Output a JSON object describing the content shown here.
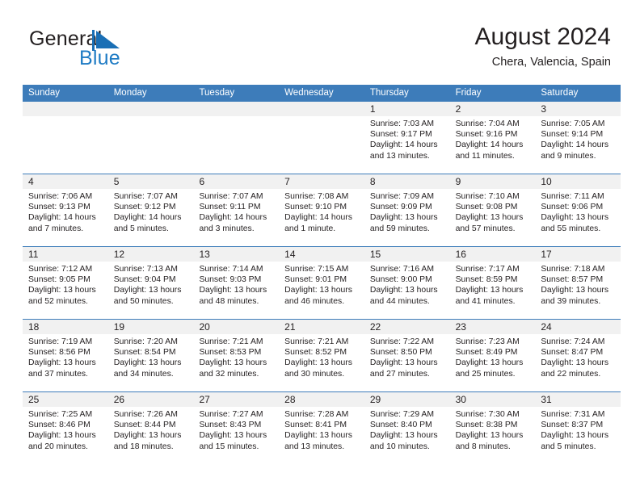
{
  "logo": {
    "word_one": "General",
    "word_two": "Blue",
    "mark": "triangle-flag-icon",
    "accent_color": "#1e7bc4"
  },
  "header": {
    "title": "August 2024",
    "location": "Chera, Valencia, Spain"
  },
  "theme": {
    "header_bar": "#3d7cba",
    "date_band": "#f1f1f1",
    "text": "#231f20",
    "rule": "#3d7cba"
  },
  "weekday_headers": [
    "Sunday",
    "Monday",
    "Tuesday",
    "Wednesday",
    "Thursday",
    "Friday",
    "Saturday"
  ],
  "weeks": [
    [
      {
        "day": "",
        "empty": true,
        "sunrise": "",
        "sunset": "",
        "daylight_a": "",
        "daylight_b": ""
      },
      {
        "day": "",
        "empty": true,
        "sunrise": "",
        "sunset": "",
        "daylight_a": "",
        "daylight_b": ""
      },
      {
        "day": "",
        "empty": true,
        "sunrise": "",
        "sunset": "",
        "daylight_a": "",
        "daylight_b": ""
      },
      {
        "day": "",
        "empty": true,
        "sunrise": "",
        "sunset": "",
        "daylight_a": "",
        "daylight_b": ""
      },
      {
        "day": "1",
        "sunrise": "Sunrise: 7:03 AM",
        "sunset": "Sunset: 9:17 PM",
        "daylight_a": "Daylight: 14 hours",
        "daylight_b": "and 13 minutes."
      },
      {
        "day": "2",
        "sunrise": "Sunrise: 7:04 AM",
        "sunset": "Sunset: 9:16 PM",
        "daylight_a": "Daylight: 14 hours",
        "daylight_b": "and 11 minutes."
      },
      {
        "day": "3",
        "sunrise": "Sunrise: 7:05 AM",
        "sunset": "Sunset: 9:14 PM",
        "daylight_a": "Daylight: 14 hours",
        "daylight_b": "and 9 minutes."
      }
    ],
    [
      {
        "day": "4",
        "sunrise": "Sunrise: 7:06 AM",
        "sunset": "Sunset: 9:13 PM",
        "daylight_a": "Daylight: 14 hours",
        "daylight_b": "and 7 minutes."
      },
      {
        "day": "5",
        "sunrise": "Sunrise: 7:07 AM",
        "sunset": "Sunset: 9:12 PM",
        "daylight_a": "Daylight: 14 hours",
        "daylight_b": "and 5 minutes."
      },
      {
        "day": "6",
        "sunrise": "Sunrise: 7:07 AM",
        "sunset": "Sunset: 9:11 PM",
        "daylight_a": "Daylight: 14 hours",
        "daylight_b": "and 3 minutes."
      },
      {
        "day": "7",
        "sunrise": "Sunrise: 7:08 AM",
        "sunset": "Sunset: 9:10 PM",
        "daylight_a": "Daylight: 14 hours",
        "daylight_b": "and 1 minute."
      },
      {
        "day": "8",
        "sunrise": "Sunrise: 7:09 AM",
        "sunset": "Sunset: 9:09 PM",
        "daylight_a": "Daylight: 13 hours",
        "daylight_b": "and 59 minutes."
      },
      {
        "day": "9",
        "sunrise": "Sunrise: 7:10 AM",
        "sunset": "Sunset: 9:08 PM",
        "daylight_a": "Daylight: 13 hours",
        "daylight_b": "and 57 minutes."
      },
      {
        "day": "10",
        "sunrise": "Sunrise: 7:11 AM",
        "sunset": "Sunset: 9:06 PM",
        "daylight_a": "Daylight: 13 hours",
        "daylight_b": "and 55 minutes."
      }
    ],
    [
      {
        "day": "11",
        "sunrise": "Sunrise: 7:12 AM",
        "sunset": "Sunset: 9:05 PM",
        "daylight_a": "Daylight: 13 hours",
        "daylight_b": "and 52 minutes."
      },
      {
        "day": "12",
        "sunrise": "Sunrise: 7:13 AM",
        "sunset": "Sunset: 9:04 PM",
        "daylight_a": "Daylight: 13 hours",
        "daylight_b": "and 50 minutes."
      },
      {
        "day": "13",
        "sunrise": "Sunrise: 7:14 AM",
        "sunset": "Sunset: 9:03 PM",
        "daylight_a": "Daylight: 13 hours",
        "daylight_b": "and 48 minutes."
      },
      {
        "day": "14",
        "sunrise": "Sunrise: 7:15 AM",
        "sunset": "Sunset: 9:01 PM",
        "daylight_a": "Daylight: 13 hours",
        "daylight_b": "and 46 minutes."
      },
      {
        "day": "15",
        "sunrise": "Sunrise: 7:16 AM",
        "sunset": "Sunset: 9:00 PM",
        "daylight_a": "Daylight: 13 hours",
        "daylight_b": "and 44 minutes."
      },
      {
        "day": "16",
        "sunrise": "Sunrise: 7:17 AM",
        "sunset": "Sunset: 8:59 PM",
        "daylight_a": "Daylight: 13 hours",
        "daylight_b": "and 41 minutes."
      },
      {
        "day": "17",
        "sunrise": "Sunrise: 7:18 AM",
        "sunset": "Sunset: 8:57 PM",
        "daylight_a": "Daylight: 13 hours",
        "daylight_b": "and 39 minutes."
      }
    ],
    [
      {
        "day": "18",
        "sunrise": "Sunrise: 7:19 AM",
        "sunset": "Sunset: 8:56 PM",
        "daylight_a": "Daylight: 13 hours",
        "daylight_b": "and 37 minutes."
      },
      {
        "day": "19",
        "sunrise": "Sunrise: 7:20 AM",
        "sunset": "Sunset: 8:54 PM",
        "daylight_a": "Daylight: 13 hours",
        "daylight_b": "and 34 minutes."
      },
      {
        "day": "20",
        "sunrise": "Sunrise: 7:21 AM",
        "sunset": "Sunset: 8:53 PM",
        "daylight_a": "Daylight: 13 hours",
        "daylight_b": "and 32 minutes."
      },
      {
        "day": "21",
        "sunrise": "Sunrise: 7:21 AM",
        "sunset": "Sunset: 8:52 PM",
        "daylight_a": "Daylight: 13 hours",
        "daylight_b": "and 30 minutes."
      },
      {
        "day": "22",
        "sunrise": "Sunrise: 7:22 AM",
        "sunset": "Sunset: 8:50 PM",
        "daylight_a": "Daylight: 13 hours",
        "daylight_b": "and 27 minutes."
      },
      {
        "day": "23",
        "sunrise": "Sunrise: 7:23 AM",
        "sunset": "Sunset: 8:49 PM",
        "daylight_a": "Daylight: 13 hours",
        "daylight_b": "and 25 minutes."
      },
      {
        "day": "24",
        "sunrise": "Sunrise: 7:24 AM",
        "sunset": "Sunset: 8:47 PM",
        "daylight_a": "Daylight: 13 hours",
        "daylight_b": "and 22 minutes."
      }
    ],
    [
      {
        "day": "25",
        "sunrise": "Sunrise: 7:25 AM",
        "sunset": "Sunset: 8:46 PM",
        "daylight_a": "Daylight: 13 hours",
        "daylight_b": "and 20 minutes."
      },
      {
        "day": "26",
        "sunrise": "Sunrise: 7:26 AM",
        "sunset": "Sunset: 8:44 PM",
        "daylight_a": "Daylight: 13 hours",
        "daylight_b": "and 18 minutes."
      },
      {
        "day": "27",
        "sunrise": "Sunrise: 7:27 AM",
        "sunset": "Sunset: 8:43 PM",
        "daylight_a": "Daylight: 13 hours",
        "daylight_b": "and 15 minutes."
      },
      {
        "day": "28",
        "sunrise": "Sunrise: 7:28 AM",
        "sunset": "Sunset: 8:41 PM",
        "daylight_a": "Daylight: 13 hours",
        "daylight_b": "and 13 minutes."
      },
      {
        "day": "29",
        "sunrise": "Sunrise: 7:29 AM",
        "sunset": "Sunset: 8:40 PM",
        "daylight_a": "Daylight: 13 hours",
        "daylight_b": "and 10 minutes."
      },
      {
        "day": "30",
        "sunrise": "Sunrise: 7:30 AM",
        "sunset": "Sunset: 8:38 PM",
        "daylight_a": "Daylight: 13 hours",
        "daylight_b": "and 8 minutes."
      },
      {
        "day": "31",
        "sunrise": "Sunrise: 7:31 AM",
        "sunset": "Sunset: 8:37 PM",
        "daylight_a": "Daylight: 13 hours",
        "daylight_b": "and 5 minutes."
      }
    ]
  ]
}
